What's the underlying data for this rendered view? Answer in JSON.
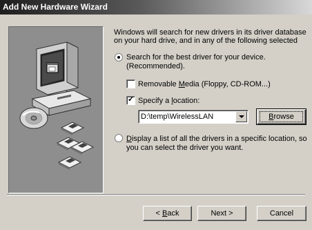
{
  "window": {
    "title": "Add New Hardware Wizard"
  },
  "intro": {
    "line1": "Windows will search for new drivers in its driver database",
    "line2": "on your hard drive, and in any of the following selected"
  },
  "option_search": {
    "line1": "Search for the best driver for your device.",
    "line2": "(Recommended).",
    "selected": true
  },
  "removable_media": {
    "pre": "Removable ",
    "mnemonic": "M",
    "post": "edia (Floppy, CD-ROM...)",
    "checked": false
  },
  "specify_location": {
    "pre": "Specify a ",
    "mnemonic": "l",
    "post": "ocation:",
    "checked": true
  },
  "location_combo": {
    "value": "D:\\temp\\WirelessLAN"
  },
  "browse_button": {
    "pre": "",
    "mnemonic": "B",
    "post": "rowse"
  },
  "option_list": {
    "mnemonic": "D",
    "line1_rest": "isplay a list of all the drivers in a specific location, so",
    "line2": "you can select the driver you want.",
    "selected": false
  },
  "buttons": {
    "back_pre": "< ",
    "back_mnemonic": "B",
    "back_post": "ack",
    "next": "Next >",
    "cancel": "Cancel"
  },
  "icons": [
    "computer-icon",
    "cd-icon",
    "floppy-disk-icon",
    "radio-button-icon",
    "check-mark-icon",
    "dropdown-arrow-icon"
  ]
}
